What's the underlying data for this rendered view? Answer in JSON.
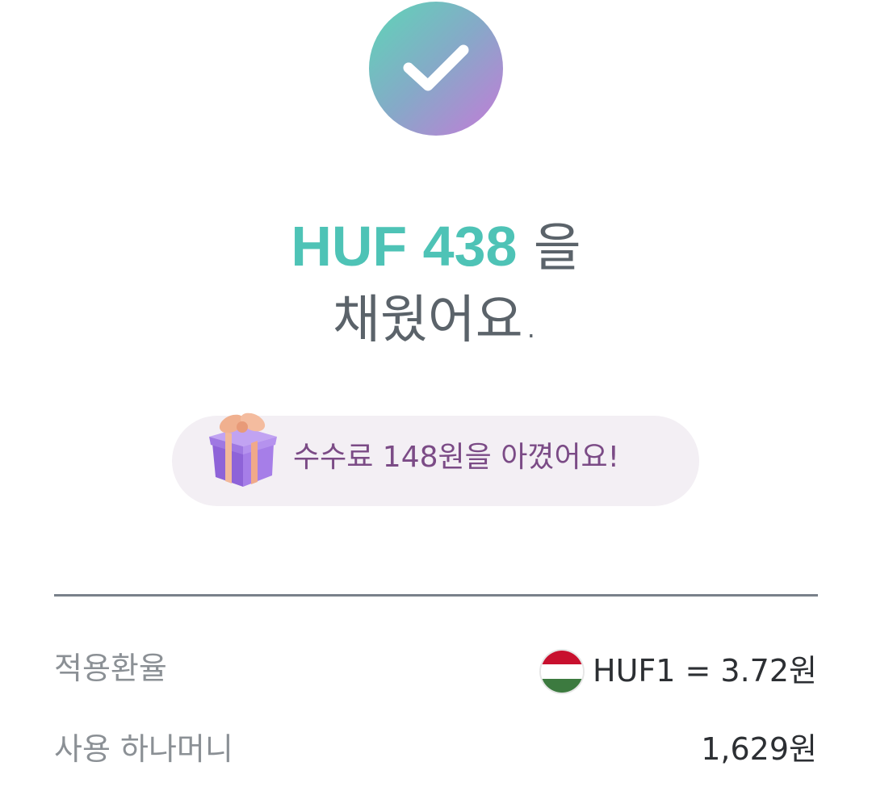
{
  "colors": {
    "accent_teal": "#4ec3b6",
    "headline_gray": "#5b636a",
    "savings_purple": "#7b4b86",
    "pill_bg": "#f3eff4",
    "divider": "#79818a"
  },
  "status": {
    "icon": "check-icon"
  },
  "headline": {
    "amount": "HUF 438",
    "particle": " 을",
    "line2": "채웠어요."
  },
  "savings": {
    "icon": "gift-icon",
    "text": "수수료 148원을 아꼈어요!"
  },
  "details": {
    "rows": [
      {
        "label": "적용환율",
        "value": "HUF1 = 3.72원",
        "flag": "hungary-flag-icon"
      },
      {
        "label": "사용 하나머니",
        "value": "1,629원"
      }
    ]
  }
}
